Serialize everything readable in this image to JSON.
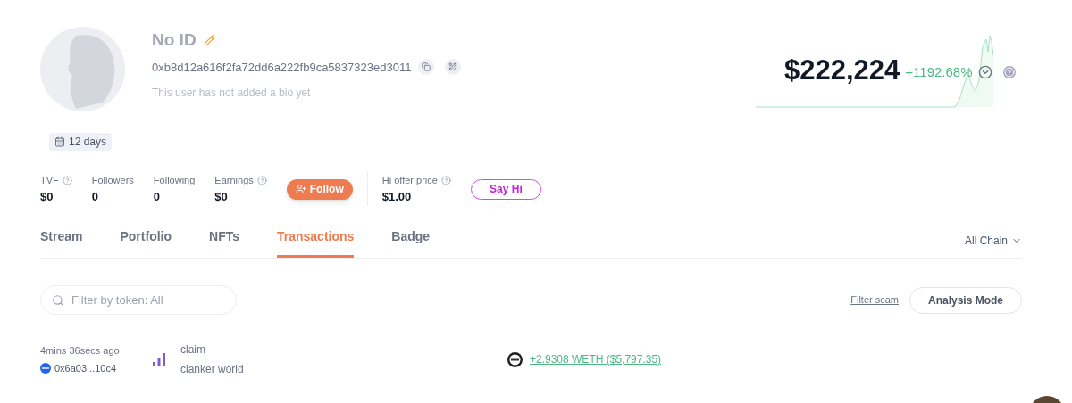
{
  "profile": {
    "name": "No ID",
    "address": "0xb8d12a616f2fa72dd6a222fb9ca5837323ed3011",
    "bio": "This user has not added a bio yet",
    "age": "12 days"
  },
  "value": {
    "amount": "$222,224",
    "change": "+1192.68%"
  },
  "stats": [
    {
      "label": "TVF",
      "value": "$0",
      "help": true
    },
    {
      "label": "Followers",
      "value": "0",
      "help": false
    },
    {
      "label": "Following",
      "value": "0",
      "help": false
    },
    {
      "label": "Earnings",
      "value": "$0",
      "help": true
    }
  ],
  "follow_button": "Follow",
  "offer": {
    "label": "Hi offer price",
    "value": "$1.00"
  },
  "say_hi_button": "Say Hi",
  "tabs": [
    {
      "label": "Stream",
      "selected": false
    },
    {
      "label": "Portfolio",
      "selected": false
    },
    {
      "label": "NFTs",
      "selected": false
    },
    {
      "label": "Transactions",
      "selected": true
    },
    {
      "label": "Badge",
      "selected": false
    }
  ],
  "chain_filter": "All Chain",
  "search": {
    "placeholder": "Filter by token: All"
  },
  "filter_scam": "Filter scam",
  "analysis_button": "Analysis Mode",
  "transactions": [
    {
      "time": "4mins 36secs ago",
      "address": "0x6a03...10c4",
      "action": "claim",
      "project": "clanker world",
      "amount": "+2.9308 WETH ($5,797.35)"
    }
  ]
}
